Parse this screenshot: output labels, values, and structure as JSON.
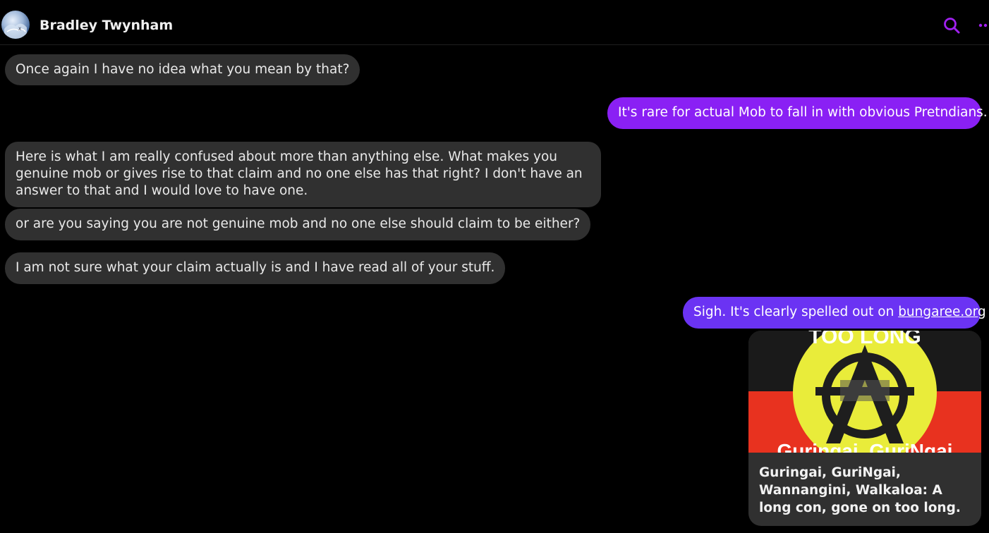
{
  "header": {
    "contact_name": "Bradley Twynham"
  },
  "icons": {
    "search": "search-icon",
    "more": "more-options-icon",
    "avatar": "profile-avatar"
  },
  "colors": {
    "outgoing": "#8a20f4",
    "outgoing_link": "#6b33f3",
    "incoming": "#303030",
    "accent_icons": "#a020f0"
  },
  "messages": [
    {
      "from": "them",
      "text": "Once again I have no idea what you mean by that?"
    },
    {
      "from": "me",
      "text": "It's rare for actual Mob to fall in with obvious Pretndians."
    },
    {
      "from": "them",
      "text": "Here is what I am really confused about more than anything else. What makes you genuine mob or gives rise to that claim and no one else has that right? I don't have an answer to that and I would love to have one."
    },
    {
      "from": "them",
      "text": "or are you saying you are not genuine mob and no one else should claim to be either?"
    },
    {
      "from": "them",
      "text": "I am not sure what your claim actually is and I have read all of your stuff."
    },
    {
      "from": "me",
      "text_prefix": "Sigh. It's clearly spelled out on ",
      "link": "bungaree.org"
    }
  ],
  "link_preview": {
    "image_caption_top": "TOO LONG",
    "image_caption_bottom": "Guringai, GuriNgai",
    "title": "Guringai, GuriNgai, Wannangini, Walkaloa: A long con, gone on too long."
  }
}
